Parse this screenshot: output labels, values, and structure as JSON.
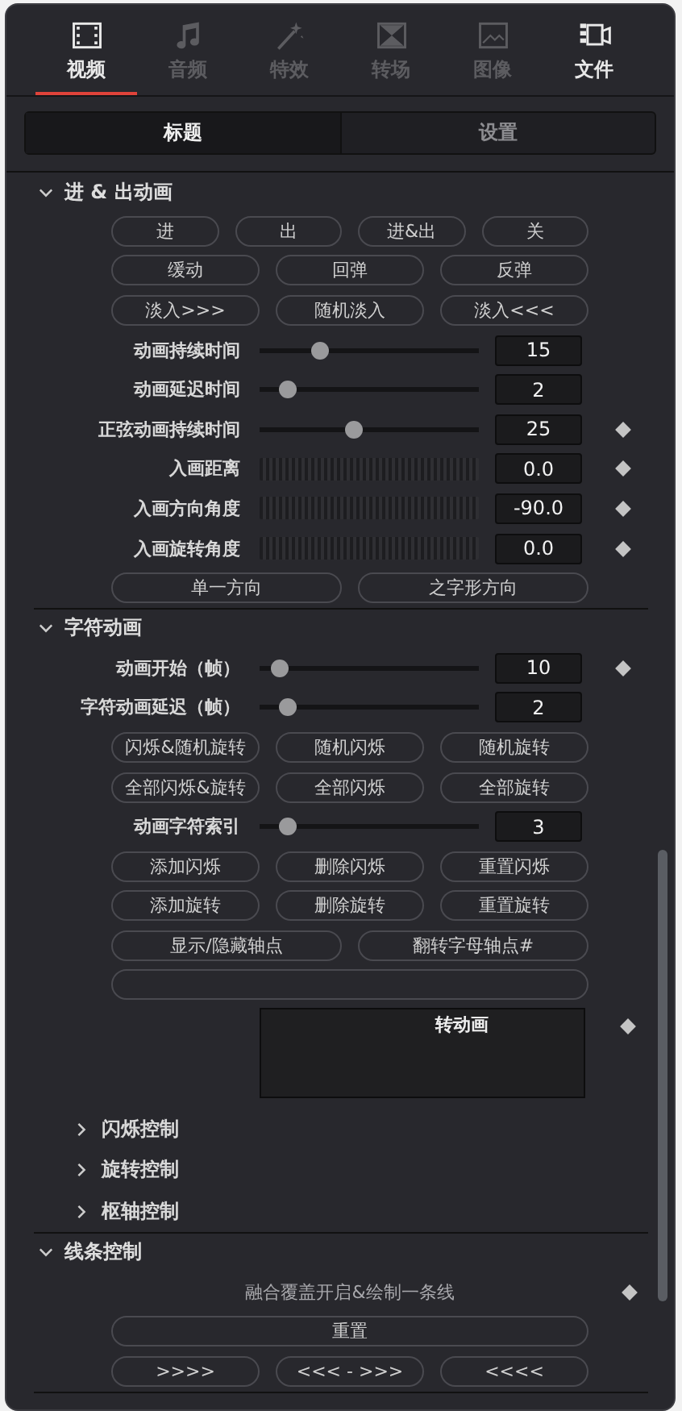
{
  "tabs": [
    {
      "label": "视频",
      "selected": true,
      "disabled": false
    },
    {
      "label": "音频",
      "selected": false,
      "disabled": true
    },
    {
      "label": "特效",
      "selected": false,
      "disabled": true
    },
    {
      "label": "转场",
      "selected": false,
      "disabled": true
    },
    {
      "label": "图像",
      "selected": false,
      "disabled": true
    },
    {
      "label": "文件",
      "selected": false,
      "disabled": false
    }
  ],
  "subtabs": [
    {
      "label": "标题",
      "selected": true
    },
    {
      "label": "设置",
      "selected": false
    }
  ],
  "sections": [
    {
      "title": "进 & 出动画",
      "expanded": true,
      "items": [
        {
          "kind": "buttons",
          "buttons": [
            {
              "label": "进"
            },
            {
              "label": "出"
            },
            {
              "label": "进&出"
            },
            {
              "label": "关"
            }
          ]
        },
        {
          "kind": "buttons",
          "buttons": [
            {
              "label": "缓动"
            },
            {
              "label": "回弹"
            },
            {
              "label": "反弹"
            }
          ]
        },
        {
          "kind": "buttons",
          "buttons": [
            {
              "label": "淡入>>>"
            },
            {
              "label": "随机淡入"
            },
            {
              "label": "淡入<<<"
            }
          ]
        },
        {
          "kind": "slider",
          "label": "动画持续时间",
          "level": 0.27,
          "value": "15",
          "keyframe": false
        },
        {
          "kind": "slider",
          "label": "动画延迟时间",
          "level": 0.125,
          "value": "2",
          "keyframe": false
        },
        {
          "kind": "slider",
          "label": "正弦动画持续时间",
          "level": 0.43,
          "value": "25",
          "keyframe": true
        },
        {
          "kind": "dial",
          "label": "入画距离",
          "value": "0.0",
          "keyframe": true
        },
        {
          "kind": "dial",
          "label": "入画方向角度",
          "value": "-90.0",
          "keyframe": true
        },
        {
          "kind": "dial",
          "label": "入画旋转角度",
          "value": "0.0",
          "keyframe": true
        },
        {
          "kind": "buttons",
          "buttons": [
            {
              "label": "单一方向"
            },
            {
              "label": "之字形方向"
            }
          ]
        }
      ]
    },
    {
      "title": "字符动画",
      "expanded": true,
      "items": [
        {
          "kind": "slider",
          "label": "动画开始（帧）",
          "level": 0.09,
          "value": "10",
          "keyframe": true
        },
        {
          "kind": "slider",
          "label": "字符动画延迟（帧）",
          "level": 0.125,
          "value": "2",
          "keyframe": false
        },
        {
          "kind": "buttons",
          "buttons": [
            {
              "label": "闪烁&随机旋转"
            },
            {
              "label": "随机闪烁"
            },
            {
              "label": "随机旋转"
            }
          ]
        },
        {
          "kind": "buttons",
          "buttons": [
            {
              "label": "全部闪烁&旋转"
            },
            {
              "label": "全部闪烁"
            },
            {
              "label": "全部旋转"
            }
          ]
        },
        {
          "kind": "slider",
          "label": "动画字符索引",
          "level": 0.125,
          "value": "3",
          "keyframe": false
        },
        {
          "kind": "buttons",
          "buttons": [
            {
              "label": "添加闪烁"
            },
            {
              "label": "删除闪烁"
            },
            {
              "label": "重置闪烁"
            }
          ]
        },
        {
          "kind": "buttons",
          "buttons": [
            {
              "label": "添加旋转"
            },
            {
              "label": "删除旋转"
            },
            {
              "label": "重置旋转"
            }
          ]
        },
        {
          "kind": "buttons",
          "buttons": [
            {
              "label": "显示/隐藏轴点"
            },
            {
              "label": "翻转字母轴点#"
            }
          ]
        },
        {
          "kind": "blank_button"
        },
        {
          "kind": "textbox",
          "value": "转动画",
          "keyframe": true
        },
        {
          "kind": "subsection",
          "title": "闪烁控制",
          "expanded": false
        },
        {
          "kind": "subsection",
          "title": "旋转控制",
          "expanded": false
        },
        {
          "kind": "subsection",
          "title": "枢轴控制",
          "expanded": false
        }
      ]
    },
    {
      "title": "线条控制",
      "expanded": true,
      "items": [
        {
          "kind": "label",
          "text": "融合覆盖开启&绘制一条线",
          "keyframe": true
        },
        {
          "kind": "buttons",
          "buttons": [
            {
              "label": "重置"
            }
          ]
        },
        {
          "kind": "buttons",
          "buttons": [
            {
              "label": ">>>>"
            },
            {
              "label": "<<< - >>>"
            },
            {
              "label": "<<<<"
            }
          ]
        }
      ]
    }
  ]
}
